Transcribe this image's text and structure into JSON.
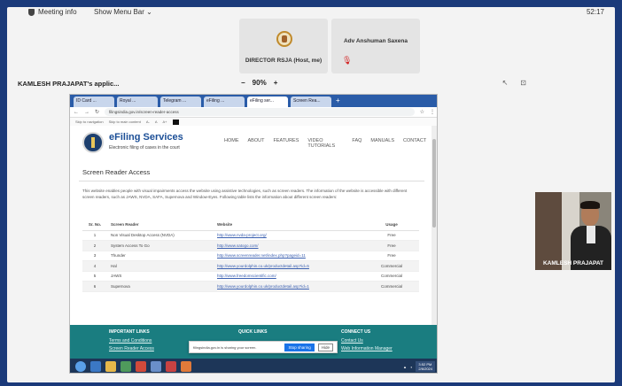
{
  "meeting": {
    "meeting_info_label": "Meeting info",
    "menu_bar_label": "Show Menu Bar",
    "clock": "52:17"
  },
  "participants": [
    {
      "name": "DIRECTOR RSJA (Host, me)"
    },
    {
      "name": "Adv Anshuman Saxena"
    }
  ],
  "share": {
    "title": "KAMLESH PRAJAPAT's applic...",
    "zoom_minus": "−",
    "zoom_level": "90%",
    "zoom_plus": "+"
  },
  "browser": {
    "tabs": [
      "ID Card ...",
      "Royal ...",
      "Telegram ...",
      "eFiling ...",
      "eFiling ser...",
      "Screen Rea..."
    ],
    "url": "filingsindia.gov.in/screen-reader-access",
    "bookmarks": [
      "Skip to navigation",
      "Skip to main content",
      "A-",
      "A",
      "A+"
    ]
  },
  "site": {
    "brand": "eFiling Services",
    "tagline": "Electronic filing of cases in the court",
    "nav": [
      "HOME",
      "ABOUT",
      "FEATURES",
      "VIDEO TUTORIALS",
      "FAQ",
      "MANUALS",
      "CONTACT"
    ],
    "page_title": "Screen Reader Access",
    "intro": "This website enables people with visual impairments access the website using assistive technologies, such as screen readers. The information of the website is accessible with different screen readers, such as JAWS, NVDA, SAFA, Supernova and Window-Eyes. Following table lists the information about different screen readers:",
    "table": {
      "headers": [
        "Sr. No.",
        "Screen Reader",
        "Website",
        "Usage"
      ],
      "rows": [
        [
          "1",
          "Non Visual Desktop Access (NVDA)",
          "http://www.nvda-project.org/",
          "Free"
        ],
        [
          "2",
          "System Access To Go",
          "http://www.satogo.com/",
          "Free"
        ],
        [
          "3",
          "Thunder",
          "http://www.screenreader.net/index.php?pageid=11",
          "Free"
        ],
        [
          "4",
          "Hal",
          "http://www.yourdolphin.co.uk/productdetail.asp?id=5",
          "Commercial"
        ],
        [
          "5",
          "JAWS",
          "http://www.freedomscientific.com/",
          "Commercial"
        ],
        [
          "6",
          "Supernova",
          "http://www.yourdolphin.co.uk/productdetail.asp?id=1",
          "Commercial"
        ]
      ]
    },
    "footer": {
      "col1_title": "IMPORTANT LINKS",
      "col1_links": [
        "Terms and Conditions",
        "Screen Reader Access"
      ],
      "col2_title": "QUICK LINKS",
      "col3_title": "CONNECT US",
      "col3_links": [
        "Contact Us",
        "Web Information Manager"
      ]
    },
    "cookie": {
      "message": "filingsindia.gov.in is sharing your screen.",
      "ok_label": "Stop sharing",
      "hide_label": "Hide"
    }
  },
  "taskbar": {
    "time": "3:52 PM",
    "date": "2/6/2024"
  },
  "thumbnail": {
    "name": "KAMLESH PRAJAPAT"
  }
}
